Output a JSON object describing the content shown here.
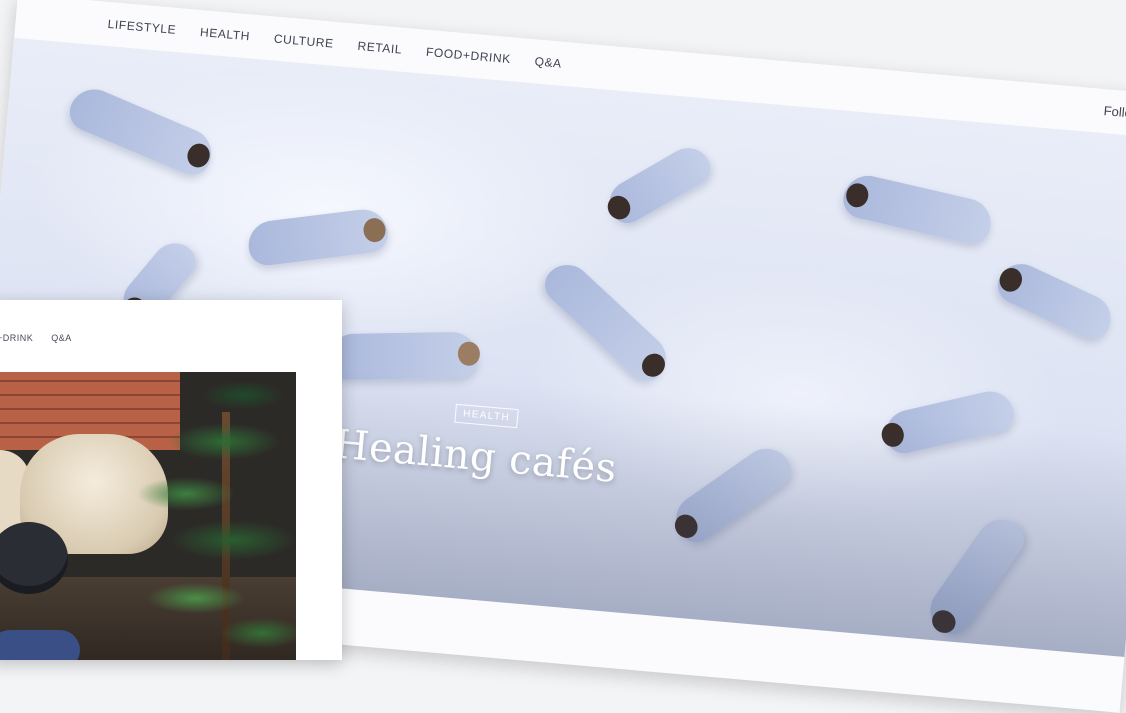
{
  "main_nav": {
    "items": [
      "LIFESTYLE",
      "HEALTH",
      "CULTURE",
      "RETAIL",
      "FOOD+DRINK",
      "Q&A"
    ],
    "follow_label": "Follo"
  },
  "hero": {
    "tag": "HEALTH",
    "title": "Healing cafés"
  },
  "secondary_nav": {
    "items": [
      "D+DRINK",
      "Q&A"
    ]
  }
}
